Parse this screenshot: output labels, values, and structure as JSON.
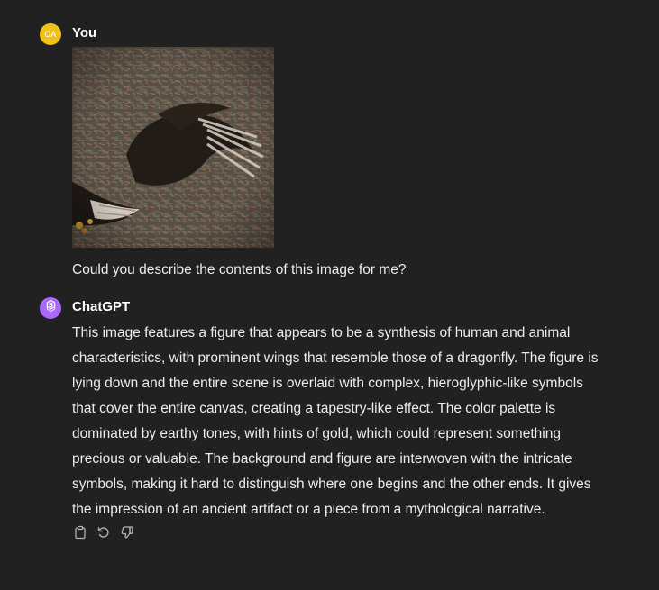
{
  "user_message": {
    "author": "You",
    "avatar_initials": "CA",
    "avatar_color": "#f2c01a",
    "prompt": "Could you describe the contents of this image for me?"
  },
  "assistant_message": {
    "author": "ChatGPT",
    "avatar_color": "#ab68ff",
    "avatar_icon": "openai-logo-icon",
    "lines": [
      "This image features a figure that appears to be a synthesis of human and animal",
      "characteristics, with prominent wings that resemble those of a dragonfly. The figure is",
      "lying down and the entire scene is overlaid with complex, hieroglyphic-like symbols",
      "that cover the entire canvas, creating a tapestry-like effect. The color palette is",
      "dominated by earthy tones, with hints of gold, which could represent something",
      "precious or valuable. The background and figure are interwoven with the intricate",
      "symbols, making it hard to distinguish where one begins and the other ends. It gives",
      "the impression of an ancient artifact or a piece from a mythological narrative."
    ],
    "actions": [
      {
        "icon": "clipboard-icon"
      },
      {
        "icon": "regenerate-icon"
      },
      {
        "icon": "thumbs-down-icon"
      }
    ]
  },
  "colors": {
    "background": "#212121",
    "text": "#ececec"
  }
}
